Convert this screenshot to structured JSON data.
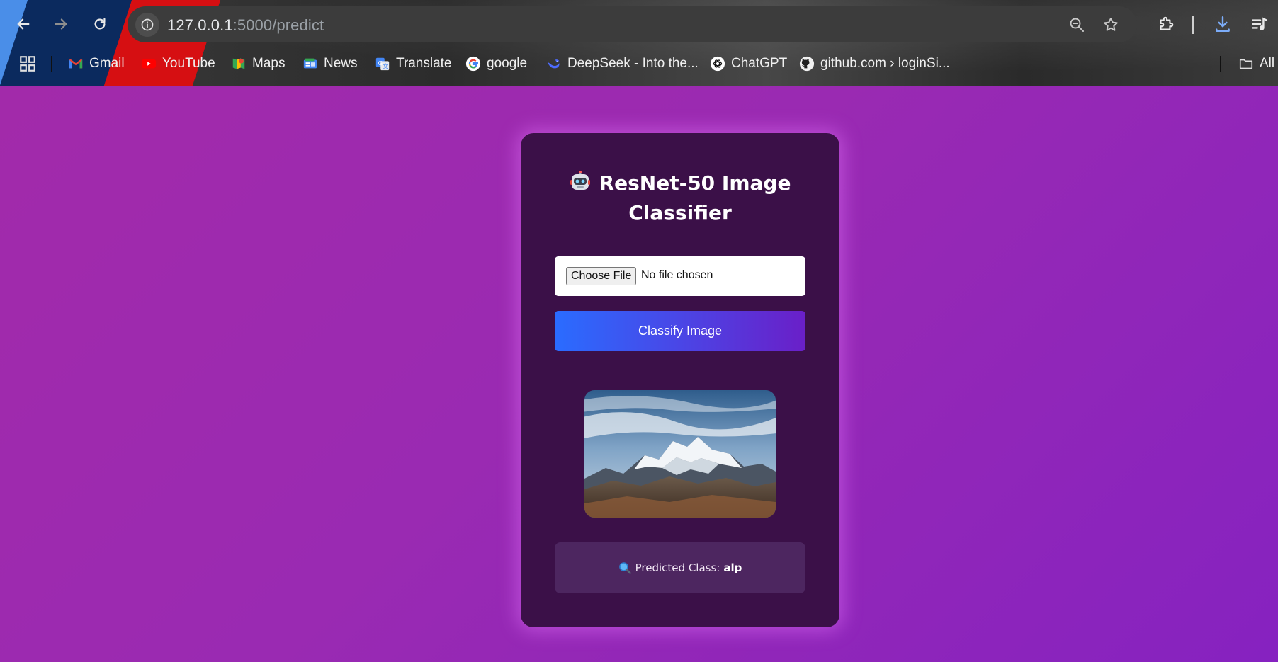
{
  "browser": {
    "url_host": "127.0.0.1",
    "url_path": ":5000/predict",
    "bookmarks": [
      {
        "label": "Gmail",
        "icon": "gmail-icon"
      },
      {
        "label": "YouTube",
        "icon": "youtube-icon"
      },
      {
        "label": "Maps",
        "icon": "maps-icon"
      },
      {
        "label": "News",
        "icon": "news-icon"
      },
      {
        "label": "Translate",
        "icon": "translate-icon"
      },
      {
        "label": "google",
        "icon": "google-icon"
      },
      {
        "label": "DeepSeek - Into the...",
        "icon": "deepseek-icon"
      },
      {
        "label": "ChatGPT",
        "icon": "chatgpt-icon"
      },
      {
        "label": "github.com › loginSi...",
        "icon": "github-icon"
      }
    ],
    "all_bookmarks_label": "All"
  },
  "app": {
    "title_line1": "ResNet-50 Image",
    "title_line2": "Classifier",
    "title_icon": "robot-icon",
    "choose_file_label": "Choose File",
    "file_status": "No file chosen",
    "classify_button": "Classify Image",
    "result_label": "Predicted Class:",
    "result_value": "alp",
    "result_icon": "magnifier-icon"
  },
  "colors": {
    "page_background": "#9a2ab2",
    "card_background": "#3b1048",
    "button_gradient_start": "#2a6cff",
    "button_gradient_end": "#6a1fc8",
    "result_background": "#4d2660"
  }
}
